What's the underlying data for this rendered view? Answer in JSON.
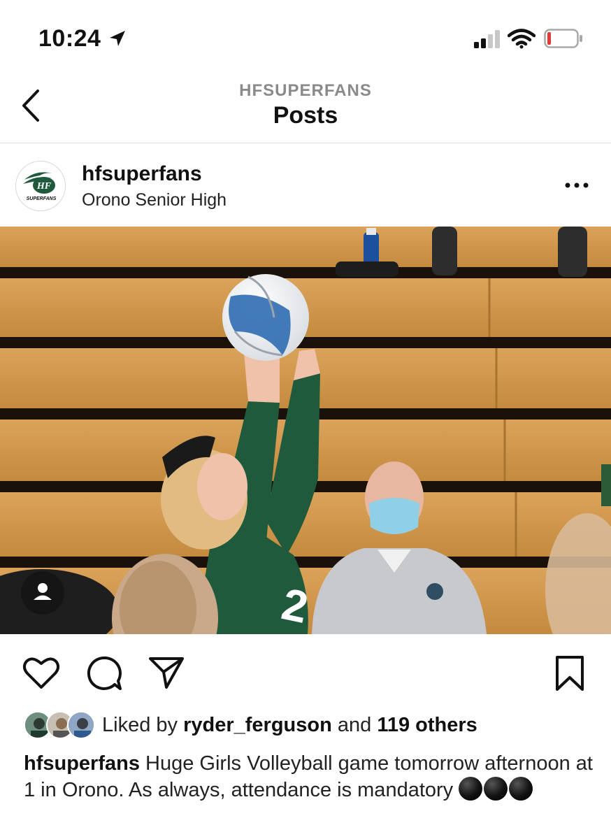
{
  "status_bar": {
    "time": "10:24",
    "battery_color": "#e53935"
  },
  "nav": {
    "subtitle": "HFSUPERFANS",
    "title": "Posts"
  },
  "post": {
    "username": "hfsuperfans",
    "location": "Orono Senior High",
    "avatar_text": "HF",
    "avatar_subtext": "SUPERFANS",
    "photo_alt": "Volleyball player in green jersey number 2 setting ball in gym"
  },
  "likes": {
    "prefix": "Liked by",
    "user": "ryder_ferguson",
    "conjunction": "and",
    "others": "119 others"
  },
  "caption": {
    "username": "hfsuperfans",
    "text": "Huge Girls Volleyball game tomorrow afternoon at 1 in Orono. As always, attendance is mandatory",
    "emoji": [
      "black-circle",
      "black-circle",
      "black-circle"
    ]
  },
  "colors": {
    "accent_green": "#1f5a3c",
    "bleacher_wood": "#d19a4e"
  }
}
